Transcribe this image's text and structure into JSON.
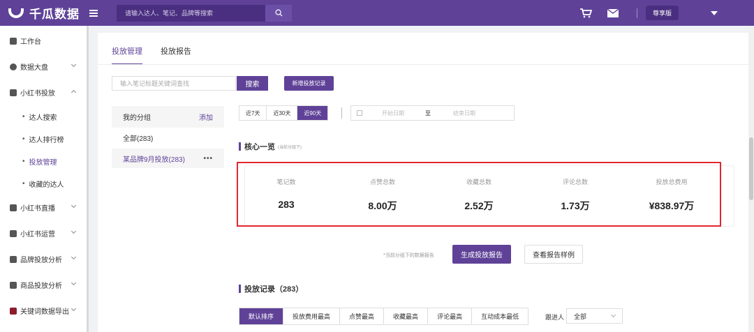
{
  "brand": {
    "name": "千瓜数据"
  },
  "search": {
    "placeholder": "请输入达人、笔记、品牌等搜索"
  },
  "header": {
    "vip_label": "尊享版"
  },
  "sidebar": {
    "items": [
      {
        "label": "工作台"
      },
      {
        "label": "数据大盘"
      },
      {
        "label": "小红书投放"
      },
      {
        "label": "小红书直播"
      },
      {
        "label": "小红书运营"
      },
      {
        "label": "品牌投放分析"
      },
      {
        "label": "商品投放分析"
      },
      {
        "label": "关键词数据导出"
      }
    ],
    "sub_items": [
      {
        "label": "达人搜索"
      },
      {
        "label": "达人排行榜"
      },
      {
        "label": "投放管理"
      },
      {
        "label": "收藏的达人"
      }
    ]
  },
  "main": {
    "tabs": [
      {
        "label": "投放管理"
      },
      {
        "label": "投放报告"
      }
    ],
    "query_placeholder": "输入笔记标题关键词查找",
    "query_button": "搜索",
    "new_record_button": "新增投放记录",
    "groups": {
      "title": "我的分组",
      "add_label": "添加",
      "rows": [
        {
          "label": "全部(283)"
        },
        {
          "label": "某品牌9月投放(283)"
        }
      ],
      "more": "•••"
    },
    "date_filter": {
      "options": [
        {
          "label": "近7天"
        },
        {
          "label": "近30天"
        },
        {
          "label": "近90天"
        }
      ],
      "start_placeholder": "开始日期",
      "to_label": "至",
      "end_placeholder": "结束日期"
    },
    "core": {
      "title": "核心一览",
      "note": "(当前分组下)",
      "stats": [
        {
          "label": "笔记数",
          "value": "283"
        },
        {
          "label": "点赞总数",
          "value": "8.00万"
        },
        {
          "label": "收藏总数",
          "value": "2.52万"
        },
        {
          "label": "评论总数",
          "value": "1.73万"
        },
        {
          "label": "投放总费用",
          "value": "¥838.97万"
        }
      ]
    },
    "report": {
      "note": "*当前分组下的数据报告",
      "generate_button": "生成投放报告",
      "sample_button": "查看报告样例"
    },
    "records": {
      "title": "投放记录（283）",
      "sorts": [
        {
          "label": "默认排序"
        },
        {
          "label": "投放费用最高"
        },
        {
          "label": "点赞最高"
        },
        {
          "label": "收藏最高"
        },
        {
          "label": "评论最高"
        },
        {
          "label": "互动成本最低"
        }
      ],
      "follow_label": "跟进人",
      "follow_value": "全部"
    }
  },
  "colors": {
    "brand": "#5f4298",
    "highlight_border": "#e0272f"
  }
}
